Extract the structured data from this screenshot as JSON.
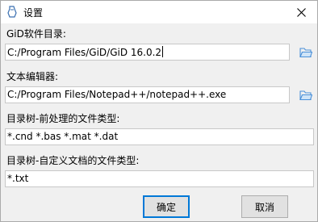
{
  "window": {
    "title": "设置"
  },
  "gid_dir": {
    "label": "GiD软件目录:",
    "value": "C:/Program Files/GiD/GiD 16.0.2"
  },
  "editor": {
    "label": "文本编辑器:",
    "value": "C:/Program Files/Notepad++/notepad++.exe"
  },
  "tree_pre": {
    "label": "目录树-前处理的文件类型:",
    "value": "*.cnd *.bas *.mat *.dat"
  },
  "tree_custom": {
    "label": "目录树-自定义文档的文件类型:",
    "value": "*.txt"
  },
  "buttons": {
    "ok": "确定",
    "cancel": "取消"
  },
  "colors": {
    "folder": "#4a90d9",
    "focus_border": "#0078d7"
  }
}
